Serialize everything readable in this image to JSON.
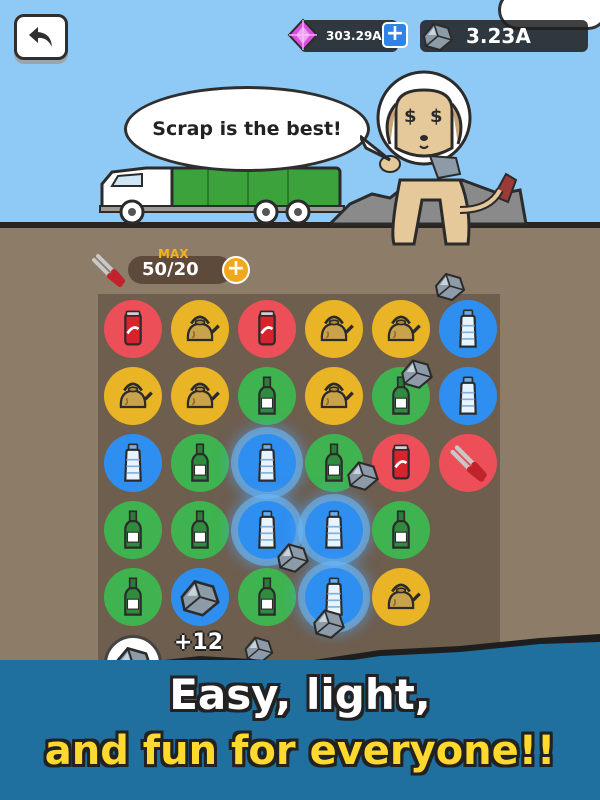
{
  "header": {
    "back_label": "back",
    "gems_value": "303.29A",
    "gems_plus": "+",
    "scrap_value": "3.23A"
  },
  "speech_bubble": {
    "text": "Scrap is the best!"
  },
  "energy": {
    "max_label": "MAX",
    "value": "50/20",
    "plus": "+"
  },
  "board": {
    "rows": [
      [
        "can-red",
        "kettle-yellow",
        "can-red",
        "kettle-yellow",
        "kettle-yellow",
        "bottle-blue"
      ],
      [
        "kettle-yellow",
        "kettle-yellow",
        "soju-green",
        "kettle-yellow",
        "soju-green",
        "bottle-blue"
      ],
      [
        "bottle-blue",
        "soju-green",
        "bottle-blue-glow",
        "soju-green",
        "can-red",
        "tongs-red"
      ],
      [
        "soju-green",
        "soju-green",
        "bottle-blue-glow",
        "bottle-blue-glow",
        "soju-green",
        "empty"
      ],
      [
        "soju-green",
        "scrap-blue",
        "soju-green",
        "bottle-blue-glow",
        "kettle-yellow",
        "empty"
      ],
      [
        "scrap-white",
        "empty",
        "empty",
        "empty",
        "empty",
        "empty"
      ]
    ],
    "gain_text": "+12"
  },
  "promo": {
    "line1": "Easy, light,",
    "line2": "and fun for everyone!!"
  },
  "colors": {
    "sky": "#8ecaf5",
    "ground": "#8d7c68",
    "banner": "#1f6f9f",
    "promo_yellow": "#ffd92e",
    "red": "#ec4f58",
    "yellow": "#e9b425",
    "green": "#3fb34f",
    "blue": "#2f8ff0"
  }
}
